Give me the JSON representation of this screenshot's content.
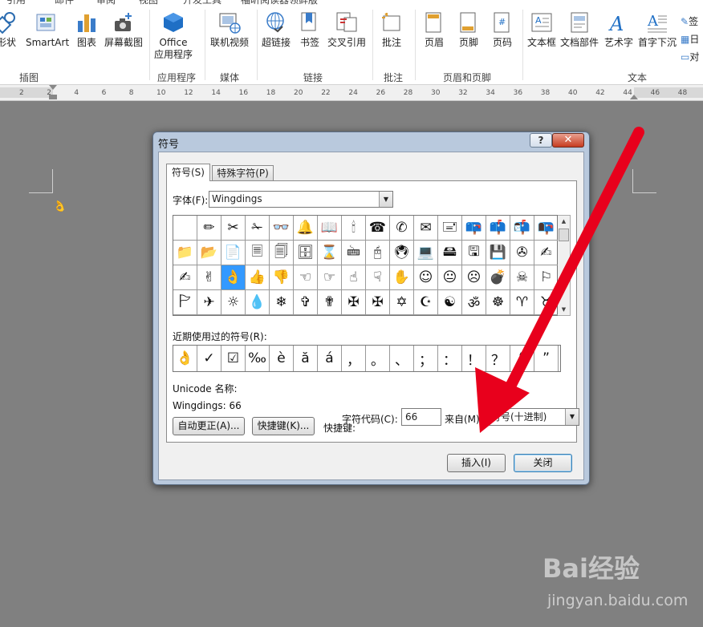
{
  "ribbon": {
    "tabs_partial": [
      "引用",
      "邮件",
      "审阅",
      "视图",
      "开发工具",
      "福昕阅读器领鲜版"
    ],
    "buttons": {
      "shapes": "形状",
      "smartart": "SmartArt",
      "chart": "图表",
      "screenshot": "屏幕截图",
      "office_apps_line1": "Office",
      "office_apps_line2": "应用程序",
      "online_video": "联机视频",
      "hyperlink": "超链接",
      "bookmark": "书签",
      "cross_ref": "交叉引用",
      "comment": "批注",
      "header": "页眉",
      "footer": "页脚",
      "page_number": "页码",
      "textbox": "文本框",
      "quick_parts": "文档部件",
      "wordart": "艺术字",
      "dropcap": "首字下沉",
      "side_item_1": "签",
      "side_item_2": "日",
      "side_item_3": "对"
    },
    "groups": {
      "illustrations": "插图",
      "apps": "应用程序",
      "media": "媒体",
      "links": "链接",
      "comments": "批注",
      "header_footer": "页眉和页脚",
      "text": "文本"
    }
  },
  "ruler": {
    "numbers": [
      "2",
      "2",
      "4",
      "6",
      "8",
      "10",
      "12",
      "14",
      "16",
      "18",
      "20",
      "22",
      "24",
      "26",
      "28",
      "30",
      "32",
      "34",
      "36",
      "38",
      "40",
      "42",
      "44",
      "46",
      "48"
    ]
  },
  "dialog": {
    "title": "符号",
    "help_glyph": "?",
    "close_glyph": "✕",
    "tabs": {
      "symbols": "符号(S)",
      "special": "特殊字符(P)"
    },
    "font_label": "字体(F):",
    "font_value": "Wingdings",
    "symbol_grid": [
      "",
      "✏",
      "✂",
      "✁",
      "👓",
      "🔔",
      "📖",
      "🕯",
      "☎",
      "✆",
      "✉",
      "🖃",
      "📪",
      "📫",
      "📬",
      "📭",
      "📁",
      "📂",
      "📄",
      "🗏",
      "🗐",
      "🗄",
      "⌛",
      "🖮",
      "🖰",
      "🖲",
      "💻",
      "🖴",
      "🖫",
      "💾",
      "✇",
      "✍",
      "✍",
      "✌",
      "👌",
      "👍",
      "👎",
      "☜",
      "☞",
      "☝",
      "☟",
      "✋",
      "☺",
      "😐",
      "☹",
      "💣",
      "☠",
      "⚐",
      "🏱",
      "✈",
      "☼",
      "💧",
      "❄",
      "✞",
      "✟",
      "✠",
      "✠",
      "✡",
      "☪",
      "☯",
      "ॐ",
      "☸",
      "♈",
      "♉"
    ],
    "selected_index": 34,
    "recent_label": "近期使用过的符号(R):",
    "recent_symbols": [
      "👌",
      "✓",
      "☑",
      "‰",
      "è",
      "ă",
      "á",
      "，",
      "。",
      "、",
      "；",
      "：",
      "！",
      "？",
      "“",
      "”"
    ],
    "unicode_name_label": "Unicode 名称:",
    "unicode_name_value": "Wingdings: 66",
    "char_code_label": "字符代码(C):",
    "char_code_value": "66",
    "from_label": "来自(M):",
    "from_value": "符号(十进制)",
    "autocorrect_button": "自动更正(A)...",
    "shortcut_key_button": "快捷键(K)...",
    "shortcut_label": "快捷键:",
    "insert_button": "插入(I)",
    "close_button": "关闭"
  },
  "watermark": {
    "brand": "Bai经验",
    "url": "jingyan.baidu.com"
  },
  "colors": {
    "arrow": "#e8001c",
    "selection": "#3399ff",
    "workspace": "#808080"
  }
}
